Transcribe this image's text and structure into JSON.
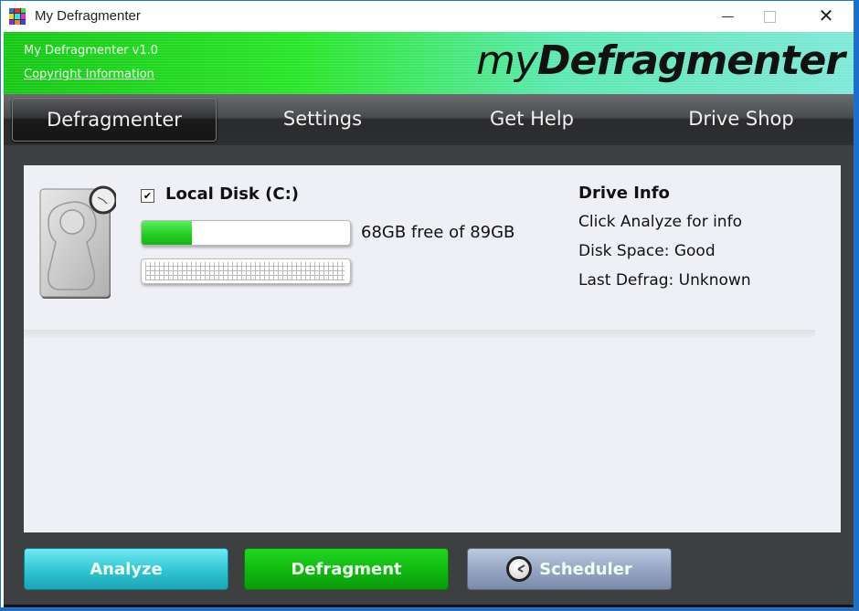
{
  "window": {
    "title": "My Defragmenter",
    "controls": {
      "minimize": "minimize",
      "maximize": "maximize",
      "close": "✕"
    }
  },
  "banner": {
    "version": "My Defragmenter v1.0",
    "copyright_link": "Copyright Information",
    "logo_my": "my",
    "logo_name": "Defragmenter"
  },
  "nav": {
    "tabs": [
      {
        "label": "Defragmenter",
        "active": true
      },
      {
        "label": "Settings",
        "active": false
      },
      {
        "label": "Get Help",
        "active": false
      },
      {
        "label": "Drive Shop",
        "active": false
      }
    ]
  },
  "drive": {
    "checked": true,
    "check_glyph": "✔",
    "name": "Local Disk (C:)",
    "free_text": "68GB free of 89GB",
    "used_fraction": 0.24,
    "fragmentation_map": "empty"
  },
  "drive_info": {
    "title": "Drive Info",
    "lines": [
      "Click Analyze for info",
      "Disk Space: Good",
      "Last Defrag: Unknown"
    ]
  },
  "actions": {
    "analyze": "Analyze",
    "defragment": "Defragment",
    "scheduler": "Scheduler"
  },
  "colors": {
    "banner_green": "#28e628",
    "analyze_cyan": "#2fc4d2",
    "defrag_green": "#10b810",
    "scheduler_blue": "#94a4c2",
    "usage_fill": "#22cc22"
  }
}
